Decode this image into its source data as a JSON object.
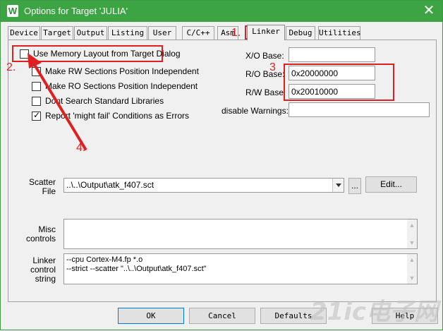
{
  "window": {
    "title": "Options for Target 'JULIA'",
    "app_icon_letter": "W"
  },
  "tabs": [
    {
      "label": "Device"
    },
    {
      "label": "Target"
    },
    {
      "label": "Output"
    },
    {
      "label": "Listing"
    },
    {
      "label": "User"
    },
    {
      "label": "C/C++"
    },
    {
      "label": "Asm"
    },
    {
      "label": "Linker"
    },
    {
      "label": "Debug"
    },
    {
      "label": "Utilities"
    }
  ],
  "annotations": {
    "n1": "1.",
    "n2": "2.",
    "n3": "3",
    "n4": "4.",
    "color": "#e02020"
  },
  "options": {
    "use_memory_layout": {
      "label": "Use Memory Layout from Target Dialog",
      "checked": false
    },
    "make_rw": {
      "label": "Make RW Sections Position Independent",
      "checked": false
    },
    "make_ro": {
      "label": "Make RO Sections Position Independent",
      "checked": false
    },
    "dont_search": {
      "label": "Dont Search Standard Libraries",
      "checked": false
    },
    "report_might_fail": {
      "label": "Report 'might fail' Conditions as Errors",
      "checked": true
    }
  },
  "fields": {
    "xo_base": {
      "label": "X/O Base:",
      "value": ""
    },
    "ro_base": {
      "label": "R/O Base:",
      "value": "0x20000000"
    },
    "rw_base": {
      "label": "R/W Base",
      "value": "0x20010000"
    },
    "disable_warnings": {
      "label": "disable Warnings:",
      "value": ""
    }
  },
  "scatter": {
    "label_line1": "Scatter",
    "label_line2": "File",
    "value": "..\\..\\Output\\atk_f407.sct",
    "browse_label": "...",
    "edit_label": "Edit..."
  },
  "misc": {
    "label_line1": "Misc",
    "label_line2": "controls",
    "value": ""
  },
  "linker_string": {
    "label_line1": "Linker",
    "label_line2": "control",
    "label_line3": "string",
    "lines": [
      "--cpu Cortex-M4.fp *.o",
      "--strict --scatter \"..\\..\\Output\\atk_f407.sct\""
    ]
  },
  "buttons": {
    "ok": "OK",
    "cancel": "Cancel",
    "defaults": "Defaults",
    "help": "Help"
  },
  "watermark": "21ic电子网"
}
